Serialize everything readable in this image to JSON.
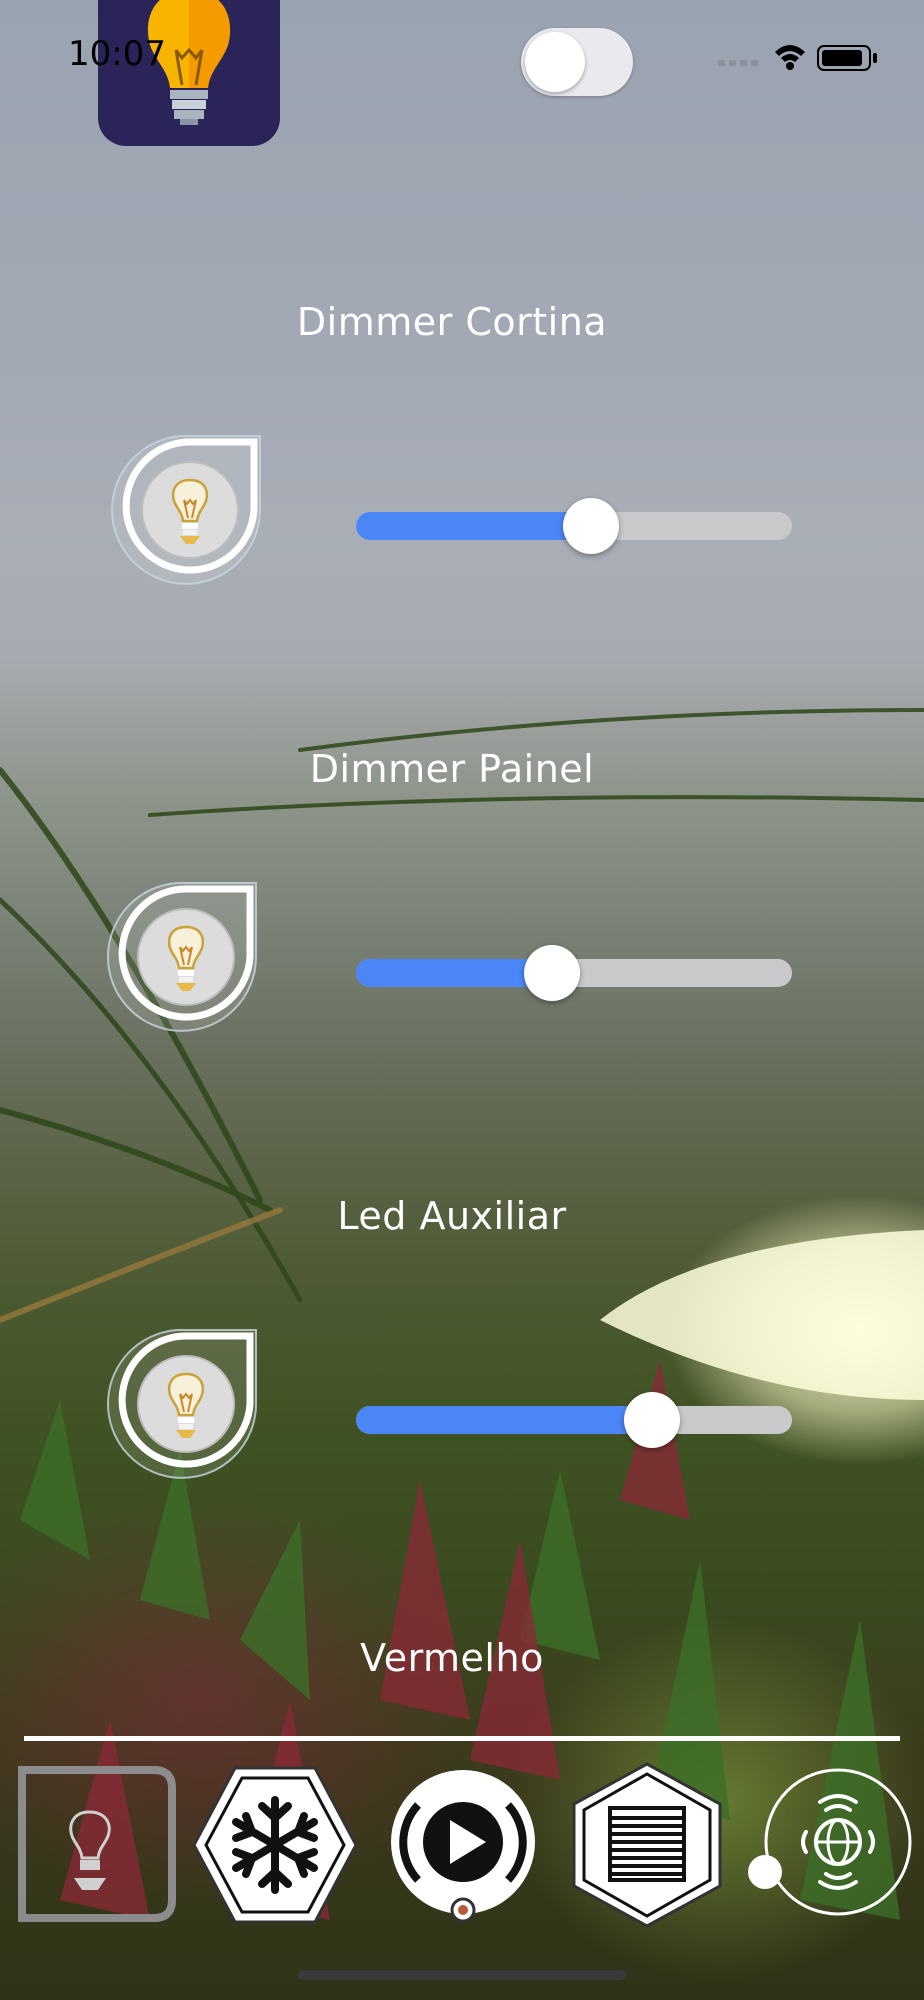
{
  "status_bar": {
    "time": "10:07"
  },
  "header": {
    "app_icon": "lightbulb-icon",
    "toggle_on": false
  },
  "dimmers": [
    {
      "label": "Dimmer Cortina",
      "level": 0.54,
      "icon": "lightbulb-icon"
    },
    {
      "label": "Dimmer Painel",
      "level": 0.45,
      "icon": "lightbulb-icon"
    },
    {
      "label": "Led Auxiliar",
      "level": 0.68,
      "icon": "lightbulb-icon"
    }
  ],
  "section_label": "Vermelho",
  "tab_bar": {
    "tabs": [
      {
        "name": "lights",
        "icon": "lightbulb-icon",
        "active": true
      },
      {
        "name": "climate",
        "icon": "snowflake-icon",
        "active": false
      },
      {
        "name": "media",
        "icon": "play-icon",
        "active": false
      },
      {
        "name": "curtains",
        "icon": "blinds-icon",
        "active": false
      },
      {
        "name": "network",
        "icon": "globe-wireless-icon",
        "active": false
      }
    ]
  },
  "colors": {
    "slider_fill": "#4a86f5",
    "slider_track": "#c9c9cb",
    "app_icon_bg": "#2a2459"
  }
}
